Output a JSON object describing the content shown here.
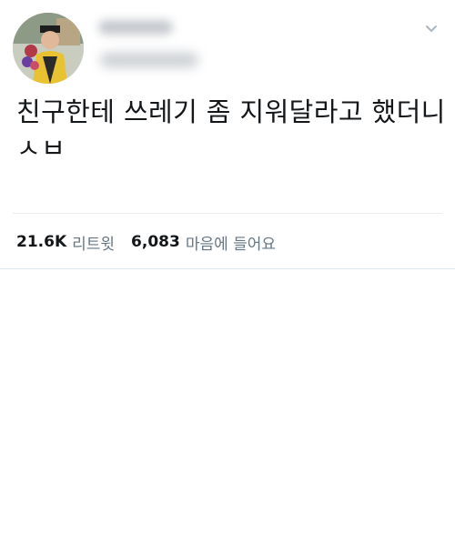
{
  "tweet": {
    "text": "친구한테 쓰레기 좀 지워달라고 했더니",
    "text_line2": "ㅅㅂ"
  },
  "stats": {
    "retweets_count": "21.6K",
    "retweets_label": "리트윗",
    "likes_count": "6,083",
    "likes_label": "마음에 들어요"
  },
  "icons": {
    "menu": "chevron-down-icon"
  },
  "colors": {
    "text": "#14171a",
    "muted": "#657786",
    "divider": "#e6ecf0"
  }
}
